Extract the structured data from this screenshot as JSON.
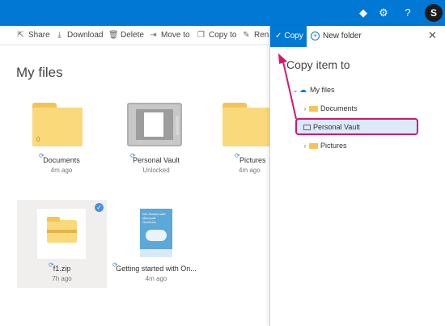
{
  "topbar": {
    "icons": [
      "diamond-icon",
      "gear-icon",
      "help-icon"
    ],
    "avatar_letter": "S"
  },
  "commands": [
    {
      "label": "Share",
      "icon": "share-icon"
    },
    {
      "label": "Download",
      "icon": "download-icon"
    },
    {
      "label": "Delete",
      "icon": "delete-icon"
    },
    {
      "label": "Move to",
      "icon": "move-icon"
    },
    {
      "label": "Copy to",
      "icon": "copy-icon"
    },
    {
      "label": "Rena",
      "icon": "rename-icon"
    }
  ],
  "page_title": "My files",
  "items": [
    {
      "name": "Documents",
      "sub": "4m ago",
      "count": "0"
    },
    {
      "name": "Personal Vault",
      "sub": "Unlocked"
    },
    {
      "name": "Pictures",
      "sub": "4m ago"
    },
    {
      "name": "f1.zip",
      "sub": "7h ago"
    },
    {
      "name": "Getting started with On...",
      "sub": "4m ago",
      "cover_text": "Get Started with Microsoft OneDrive"
    }
  ],
  "panel": {
    "copy_label": "Copy",
    "new_folder_label": "New folder",
    "title": "Copy item to",
    "tree": [
      {
        "label": "My files",
        "expanded": true
      },
      {
        "label": "Documents"
      },
      {
        "label": "Personal Vault",
        "selected": true
      },
      {
        "label": "Pictures"
      }
    ]
  },
  "colors": {
    "accent": "#0078d4",
    "highlight_border": "#d6176f",
    "selected_row": "#dbe9f8",
    "folder": "#fad97a"
  }
}
